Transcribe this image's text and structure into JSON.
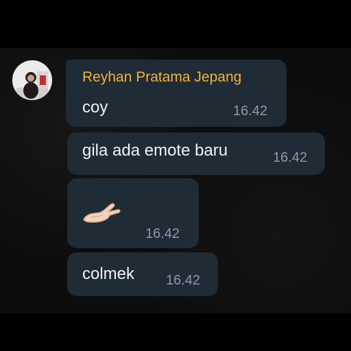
{
  "chat": {
    "sender_name": "Reyhan Pratama Jepang",
    "sender_name_color": "#f2b33d",
    "bubble_color": "#1f2b35",
    "messages": [
      {
        "text": "coy",
        "time": "16.42"
      },
      {
        "text": "gila ada emote baru",
        "time": "16.42"
      },
      {
        "emoji": "palm-up-hand-icon",
        "time": "16.42"
      },
      {
        "text": "colmek",
        "time": "16.42"
      }
    ]
  }
}
